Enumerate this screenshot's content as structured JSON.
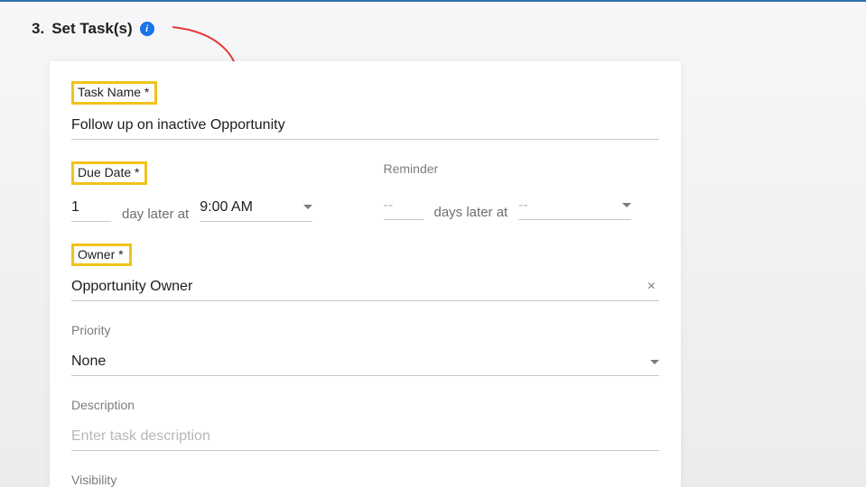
{
  "section": {
    "number": "3.",
    "title": "Set Task(s)"
  },
  "form": {
    "taskName": {
      "label": "Task Name *",
      "value": "Follow up on inactive Opportunity"
    },
    "dueDate": {
      "label": "Due Date *",
      "days": "1",
      "unitText": "day later at",
      "time": "9:00 AM"
    },
    "reminder": {
      "label": "Reminder",
      "days": "--",
      "unitText": "days later at",
      "time": "--"
    },
    "owner": {
      "label": "Owner *",
      "value": "Opportunity Owner"
    },
    "priority": {
      "label": "Priority",
      "value": "None"
    },
    "description": {
      "label": "Description",
      "placeholder": "Enter task description",
      "value": ""
    },
    "visibility": {
      "label": "Visibility"
    }
  }
}
